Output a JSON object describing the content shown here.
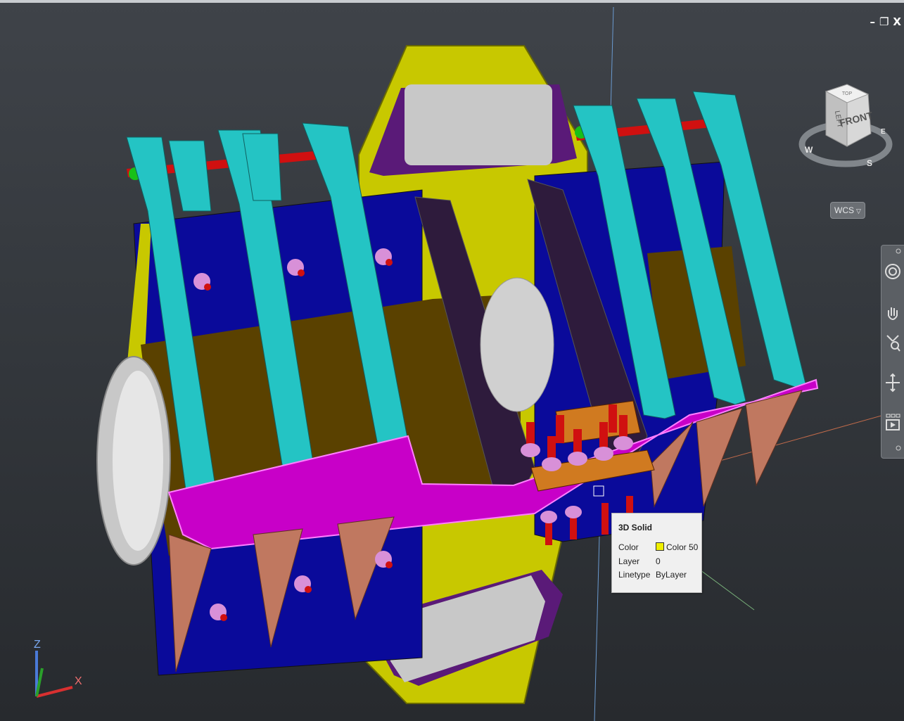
{
  "window_controls": {
    "minimize": "–",
    "restore": "❐",
    "close": "X"
  },
  "viewcube": {
    "face_front": "FRONT",
    "face_left": "LEFT",
    "face_top": "TOP",
    "compass_w": "W",
    "compass_s": "S",
    "compass_e": "E"
  },
  "wcs_menu": {
    "label": "WCS",
    "arrow": "▽"
  },
  "navbar": {
    "items": [
      "steering-wheel-icon",
      "pan-icon",
      "zoom-icon",
      "orbit-icon",
      "showmotion-icon"
    ]
  },
  "tooltip": {
    "title": "3D Solid",
    "rows": [
      {
        "label": "Color",
        "value": "Color 50",
        "swatch": "#f0f000"
      },
      {
        "label": "Layer",
        "value": "0"
      },
      {
        "label": "Linetype",
        "value": "ByLayer"
      }
    ]
  },
  "ucs_icon": {
    "x_label": "X",
    "z_label": "Z"
  },
  "colors": {
    "background_top": "#3f4349",
    "background_bottom": "#272a2e",
    "accent_yellow": "#c8c800",
    "cyan": "#24c4c4",
    "blue": "#0a0a9a",
    "magenta": "#c800c8"
  }
}
